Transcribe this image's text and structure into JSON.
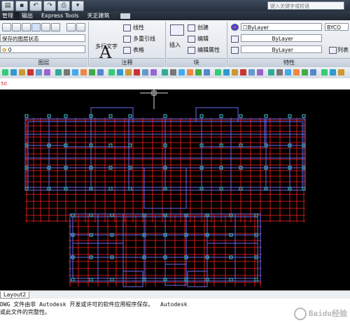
{
  "titlebar": {
    "search_placeholder": "键入关键字或短语"
  },
  "menubar": {
    "items": [
      "管理",
      "输出",
      "Express Tools",
      "天正建筑"
    ]
  },
  "ribbon": {
    "layer_state": "保存的图层状态",
    "layer_current": "0",
    "layer_panel_label": "图层",
    "text_button": "多行文字",
    "linear_label": "线性",
    "multileader_label": "多重引线",
    "table_label": "表格",
    "annotation_panel_label": "注释",
    "insert_label": "插入",
    "create_label": "创建",
    "edit_label": "编辑",
    "edit_attr_label": "编辑属性",
    "block_panel_label": "块",
    "bylayer_color": "ByLayer",
    "bylayer_linetype": "ByLayer",
    "bylayer_lineweight": "ByLayer",
    "bycolor_label": "BYCO",
    "list_label": "列表",
    "properties_panel_label": "特性"
  },
  "strip": {
    "number": "50"
  },
  "tabs": {
    "layout": "Layout2"
  },
  "command": {
    "line1": "DWG 文件由非 Autodesk 开发或许可的软件应用程序保存。  Autodesk",
    "line2": "或此文件的完整性。"
  },
  "watermark": "Baidu经验",
  "colors": {
    "grid_red": "#ff2020",
    "wall_blue": "#6a6af0",
    "column_cyan": "#40c8d8"
  }
}
